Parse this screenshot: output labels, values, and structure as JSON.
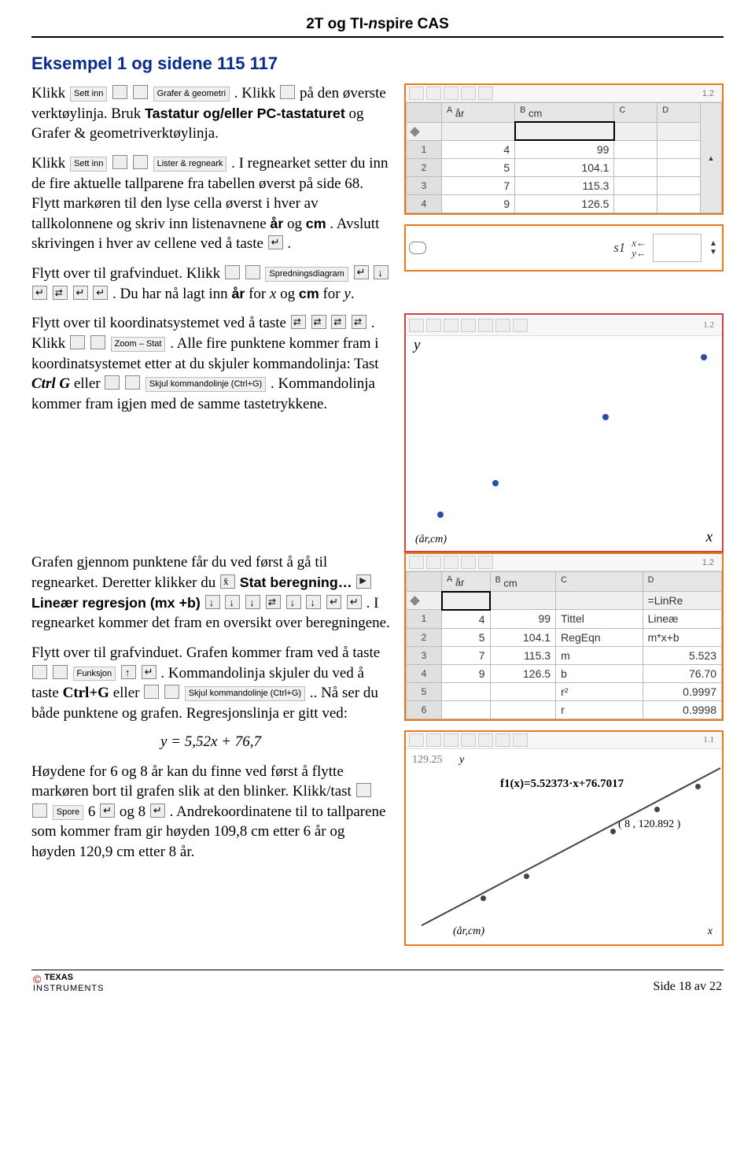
{
  "header": {
    "title_prefix": "2T og TI-",
    "title_n": "n",
    "title_suffix": "spire CAS"
  },
  "section": {
    "title": "Eksempel 1 og sidene 115  117"
  },
  "para1": {
    "t1": "Klikk ",
    "btn_settinn": "Sett inn",
    "btn_grafer": "Grafer & geometri",
    "t2": ". Klikk ",
    "t3": " på den øverste verktøylinja. Bruk ",
    "t4": "Tastatur og/eller PC-tastaturet",
    "t5": " og Grafer & geometriverktøylinja."
  },
  "para2": {
    "t1": "Klikk ",
    "btn_settinn": "Sett inn",
    "btn_lister": "Lister & regneark",
    "t2": ". I regnearket setter du inn de fire aktuelle tallparene fra tabellen øverst på side 68. Flytt markøren til den lyse cella øverst i hver av tallkolonnene og skriv inn listenavnene ",
    "t3": "år",
    "t4": " og ",
    "t5": "cm",
    "t6": ". Avslutt skrivingen i hver av cellene ved å taste ",
    "t7": "."
  },
  "para3": {
    "t1": "Flytt over til grafvinduet. Klikk ",
    "btn_spred": "Spredningsdiagram",
    "t2": ". Du har nå lagt inn ",
    "t3": "år",
    "t4": " for ",
    "t5": " og ",
    "t6": "cm",
    "t7": " for  ",
    "x": "x",
    "y": "y",
    "period": "."
  },
  "para4": {
    "t1": "Flytt over til koordinatsystemet ved å taste ",
    "t2": ". Klikk ",
    "btn_zoom": "Zoom – Stat",
    "t3": ". Alle fire punktene kommer fram i koordinatsystemet etter at du skjuler kommandolinja: Tast ",
    "ctrlg": "Ctrl G",
    "t4": " eller ",
    "btn_skjul": "Skjul kommandolinje (Ctrl+G)",
    "t5": ". Kommandolinja kommer fram igjen med de samme tastetrykkene."
  },
  "para5": {
    "t1": "Grafen gjennom punktene får du ved først å gå til regnearket. Deretter klikker du ",
    "stat": "Stat beregning…",
    "linreg": "Lineær regresjon (mx +b)",
    "t2": ". I regnearket kommer det fram en oversikt over beregningene."
  },
  "para6": {
    "t1": "Flytt over til grafvinduet. Grafen kommer fram ved å taste ",
    "btn_funk": "Funksjon",
    "t2": ". Kommandolinja skjuler du ved å taste ",
    "ctrlg": "Ctrl+G",
    "t3": " eller ",
    "btn_skjul": "Skjul kommandolinje (Ctrl+G)",
    "t4": ".. Nå ser du både punktene og grafen. Regresjonslinja er gitt ved:"
  },
  "equation": "y = 5,52x + 76,7",
  "para7": {
    "t1": "Høydene for 6 og 8 år kan du finne ved først å flytte markøren bort til grafen slik at den blinker. Klikk/tast ",
    "btn_spore": "Spore",
    "t2": " 6 ",
    "t3": " og 8 ",
    "t4": ". Andrekoordinatene til to tallparene som kommer fram gir høyden 109,8 cm\netter 6 år og høyden 120,9 cm etter 8 år."
  },
  "sheet1": {
    "tab": "1.2",
    "A": "A",
    "B": "B",
    "C": "C",
    "D": "D",
    "a_name": "år",
    "b_name": "cm",
    "rows": [
      {
        "n": "1",
        "a": "4",
        "b": "99"
      },
      {
        "n": "2",
        "a": "5",
        "b": "104.1"
      },
      {
        "n": "3",
        "a": "7",
        "b": "115.3"
      },
      {
        "n": "4",
        "a": "9",
        "b": "126.5"
      }
    ]
  },
  "graphsel": {
    "s1": "s1",
    "x": "x←",
    "y": "y←"
  },
  "scatter": {
    "tab": "1.2",
    "y": "y",
    "x": "x",
    "origin": "(år,cm)"
  },
  "sheet2": {
    "tab": "1.2",
    "A": "A",
    "B": "B",
    "C": "C",
    "D": "D",
    "a_name": "år",
    "b_name": "cm",
    "d_formula": "=LinRe",
    "rows": [
      {
        "n": "1",
        "a": "4",
        "b": "99",
        "c": "Tittel",
        "d": "Lineæ"
      },
      {
        "n": "2",
        "a": "5",
        "b": "104.1",
        "c": "RegEqn",
        "d": "m*x+b"
      },
      {
        "n": "3",
        "a": "7",
        "b": "115.3",
        "c": "m",
        "d": "5.523"
      },
      {
        "n": "4",
        "a": "9",
        "b": "126.5",
        "c": "b",
        "d": "76.70"
      },
      {
        "n": "5",
        "a": "",
        "b": "",
        "c": "r²",
        "d": "0.9997"
      },
      {
        "n": "6",
        "a": "",
        "b": "",
        "c": "r",
        "d": "0.9998"
      }
    ]
  },
  "linechart": {
    "tab": "1.1",
    "ylabel": "y",
    "ytick": "129.25",
    "eq": "f1(x)=5.52373·x+76.7017",
    "pt": "( 8 , 120.892 )",
    "origin": "(år,cm)",
    "x": "x"
  },
  "footer": {
    "brand1": "TEXAS",
    "brand2": "INSTRUMENTS",
    "page": "Side 18 av 22"
  },
  "chart_data": [
    {
      "type": "scatter",
      "x": [
        4,
        5,
        7,
        9
      ],
      "y": [
        99,
        104.1,
        115.3,
        126.5
      ],
      "xlabel": "x",
      "ylabel": "y",
      "title": "(år,cm)",
      "legend_pos": ""
    },
    {
      "type": "line",
      "x": [
        4,
        5,
        6,
        7,
        8,
        9
      ],
      "y": [
        98.8,
        104.3,
        109.8,
        115.4,
        120.9,
        126.4
      ],
      "scatter_x": [
        4,
        5,
        7,
        8,
        9
      ],
      "scatter_y": [
        99,
        104.1,
        115.3,
        120.892,
        126.5
      ],
      "title": "f1(x)=5.52373·x+76.7017",
      "annotation": "(8 , 120.892)",
      "xlim": [
        2.5,
        9.5
      ],
      "ylim": [
        80,
        130
      ],
      "xlabel": "x",
      "ylabel": "y"
    }
  ]
}
